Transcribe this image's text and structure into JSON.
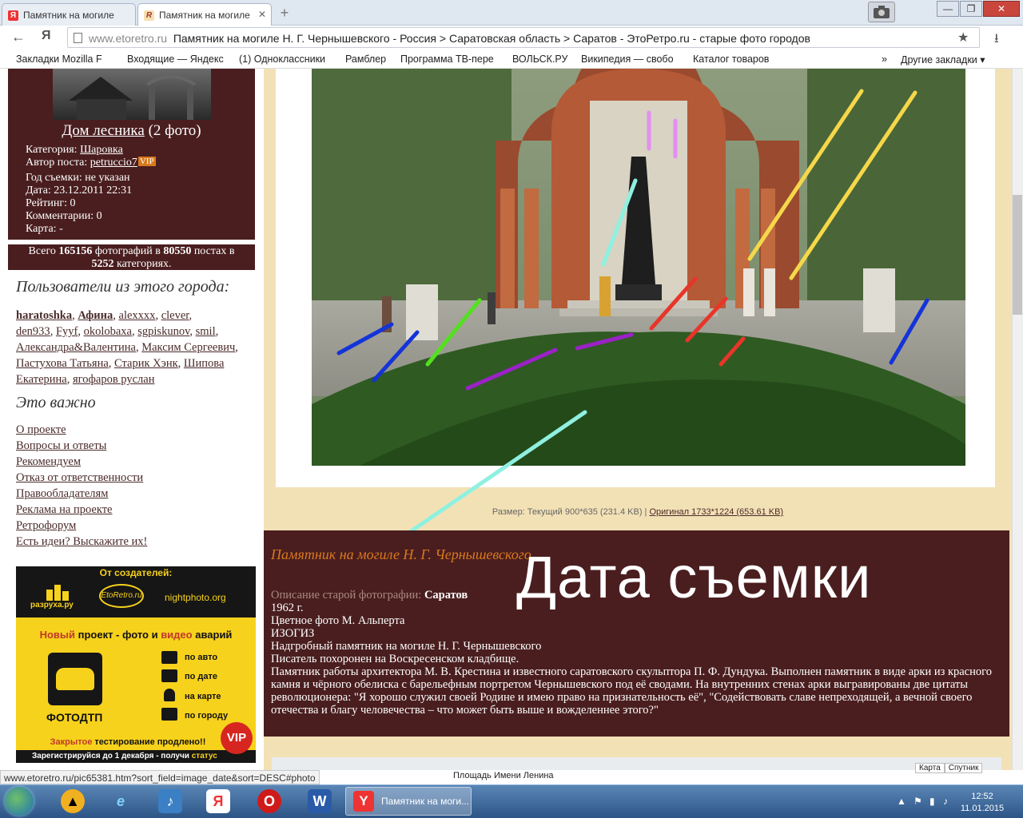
{
  "browser": {
    "tabs": [
      {
        "label": "Памятник на могиле",
        "icon": "Я"
      },
      {
        "label": "Памятник на могиле",
        "icon": "R"
      }
    ],
    "new_tab": "+",
    "window_buttons": [
      "—",
      "❐",
      "✕"
    ],
    "nav": {
      "back": "←",
      "ya": "Я",
      "star": "★",
      "download": "⭳"
    },
    "url_domain": "www.etoretro.ru",
    "url_title": "Памятник на могиле Н. Г. Чернышевского - Россия > Саратовская область > Саратов  - ЭтоРетро.ru - старые фото городов",
    "bookmarks": [
      "Закладки Mozilla F",
      "Входящие — Яндекс",
      "(1) Одноклассники",
      "Рамблер",
      "Программа ТВ-пере",
      "ВОЛЬСК.РУ",
      "Википедия — свобо",
      "Каталог товаров",
      "»",
      "Другие закладки ▾"
    ]
  },
  "sidebar": {
    "photo_title": "Дом лесника",
    "photo_count": "(2 фото)",
    "category_label": "Категория:",
    "category_value": "Шаровка",
    "author_label": "Автор поста:",
    "author_value": "petruccio7",
    "vip": "VIP",
    "year_line": "Год съемки: не указан",
    "date_line": "Дата: 23.12.2011 22:31",
    "rating_line": "Рейтинг: 0",
    "comments_line": "Комментарии: 0",
    "map_line": "Карта: -",
    "totals_1": "Всего",
    "totals_photos": "165156",
    "totals_2": "фотографий в",
    "totals_posts": "80550",
    "totals_3": "постах в",
    "totals_cats": "5252",
    "totals_4": "категориях.",
    "users_heading": "Пользователи из этого города:",
    "users": [
      "haratoshka",
      "Афина",
      "alexxxx",
      "clever",
      "den933",
      "Fyyf",
      "okolobaxa",
      "sgpiskunov",
      "smil",
      "Александра&Валентина",
      "Максим Сергеевич",
      "Пастухова Татьяна",
      "Старик Хэнк",
      "Шипова Екатерина",
      "ягофаров руслан"
    ],
    "important_heading": "Это важно",
    "important_links": [
      "О проекте",
      "Вопросы и ответы",
      "Рекомендуем",
      "Отказ от ответственности",
      "Правообладателям",
      "Реклама на проекте",
      "Ретрофорум",
      "Есть идеи? Выскажите их!"
    ]
  },
  "ad": {
    "creators": "От создателей:",
    "razruha": "разруха.ру",
    "etoretro": "EtoRetro.ru",
    "nightphoto": "nightphoto.org",
    "new_1": "Новый",
    "new_2": "проект - фото и",
    "new_3": "видео",
    "new_4": "аварий",
    "fotodtp": "ФОТОДТП",
    "options": [
      "по авто",
      "по дате",
      "на карте",
      "по городу"
    ],
    "closed_1": "Закрытое",
    "closed_2": "тестирование продлено!!",
    "register_1": "Зарегистрируйся до 1 декабря - получи",
    "register_2": "статус",
    "vip": "VIP"
  },
  "main": {
    "size_text": "Размер: Текущий 900*635 (231.4 KB) |",
    "size_original": "Оригинал 1733*1224 (653.61 KB)",
    "title": "Памятник на могиле Н. Г. Чернышевского",
    "overlay_text": "Дата съемки",
    "desc_label": "Описание старой фотографии:",
    "desc_city": "Саратов",
    "desc_lines": [
      "1962 г.",
      "Цветное фото М. Альперта",
      "ИЗОГИЗ",
      "Надгробный памятник на могиле Н. Г. Чернышевского",
      "Писатель похоронен на Воскресенском кладбище.",
      "Памятник работы архитектора М. В. Крестина и известного саратовского скульптора П. Ф. Дундука. Выполнен памятник в виде арки из красного камня и чёрного обелиска с барельефным портретом Чернышевского под её сводами. На внутренних стенах арки выгравированы две цитаты революционера: \"Я хорошо служил своей Родине и имею право на признательность её\", \"Содействовать славе непреходящей, а вечной своего отечества и благу человечества – что может быть выше и вожделеннее этого?\""
    ],
    "map_label": "Площадь Имени Ленина",
    "map_buttons": [
      "Карта",
      "Спутник"
    ]
  },
  "status_url": "www.etoretro.ru/pic65381.htm?sort_field=image_date&sort=DESC#photo",
  "taskbar": {
    "active_window": "Памятник на моги...",
    "time": "12:52",
    "date": "11.01.2015"
  }
}
